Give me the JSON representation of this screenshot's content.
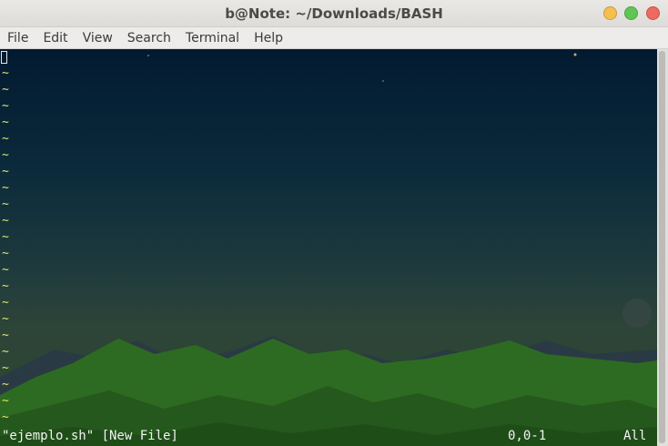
{
  "window": {
    "title": "b@Note: ~/Downloads/BASH"
  },
  "menu": {
    "items": [
      "File",
      "Edit",
      "View",
      "Search",
      "Terminal",
      "Help"
    ]
  },
  "editor": {
    "empty_line_marker": "~",
    "empty_line_count": 22,
    "status": {
      "file": "\"ejemplo.sh\" [New File]",
      "position": "0,0-1",
      "scroll": "All"
    }
  },
  "colors": {
    "tilde": "#e4e46a",
    "status_text": "#f2f2f2",
    "sky_top": "#021a30",
    "mountains": "#2e6b22"
  },
  "icons": {
    "minimize": "minimize-icon",
    "maximize": "maximize-icon",
    "close": "close-icon"
  }
}
